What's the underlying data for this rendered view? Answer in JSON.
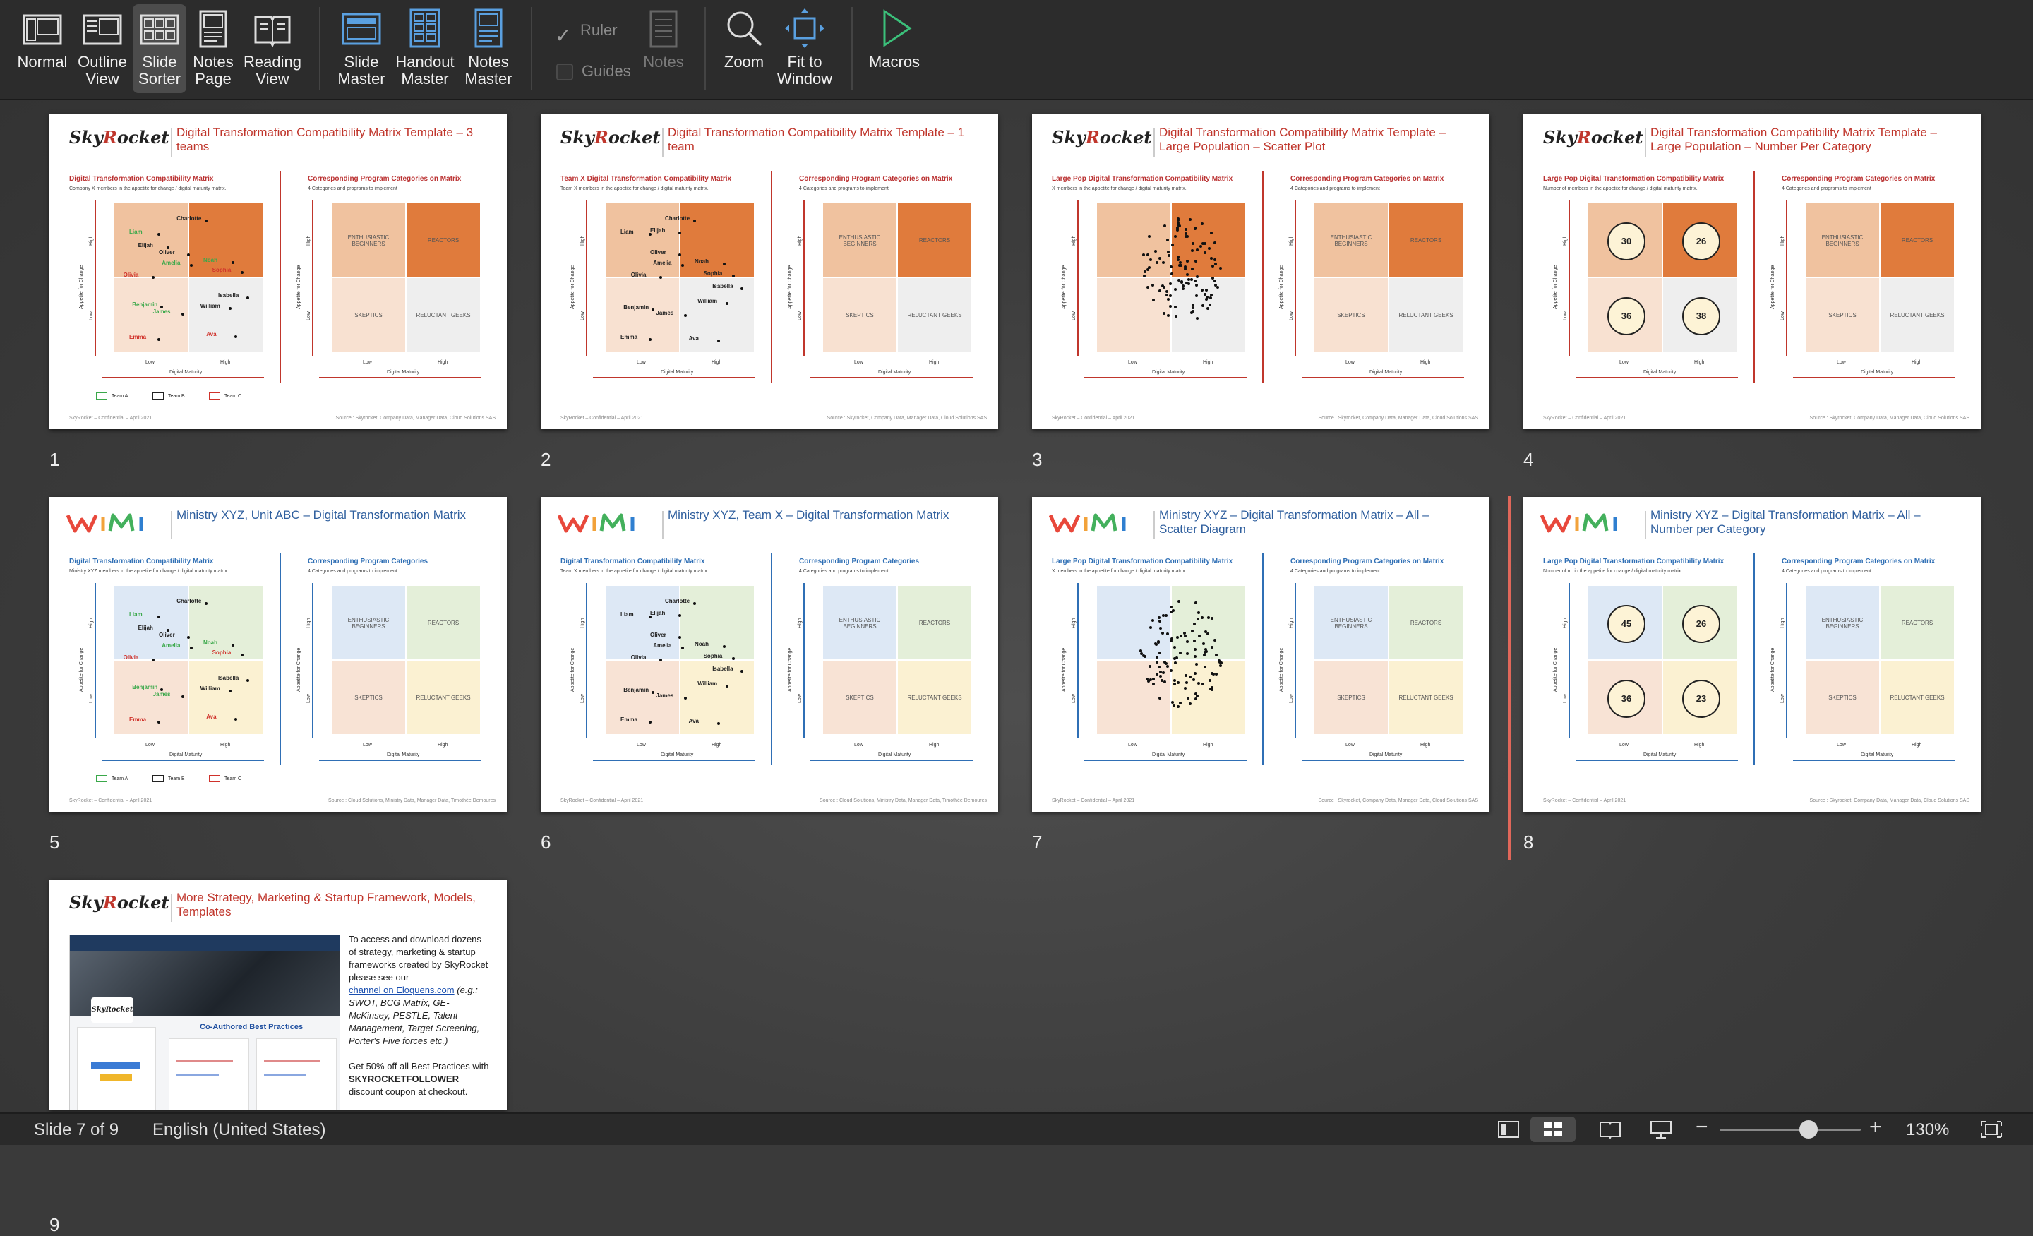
{
  "ribbon": {
    "views": [
      {
        "l1": "Normal",
        "l2": ""
      },
      {
        "l1": "Outline",
        "l2": "View"
      },
      {
        "l1": "Slide",
        "l2": "Sorter"
      },
      {
        "l1": "Notes",
        "l2": "Page"
      },
      {
        "l1": "Reading",
        "l2": "View"
      }
    ],
    "masters": [
      {
        "l1": "Slide",
        "l2": "Master"
      },
      {
        "l1": "Handout",
        "l2": "Master"
      },
      {
        "l1": "Notes",
        "l2": "Master"
      }
    ],
    "ruler_label": "Ruler",
    "guides_label": "Guides",
    "notes_label": "Notes",
    "zoom_label": "Zoom",
    "fit_l1": "Fit to",
    "fit_l2": "Window",
    "macros_label": "Macros"
  },
  "slides": [
    {
      "num": "1",
      "logo": "SkyRocket",
      "title": "Digital Transformation Compatibility Matrix Template – 3 teams",
      "left_sub": "Digital Transformation Compatibility Matrix",
      "left_desc": "Company X members in the appetite for change / digital maturity matrix.",
      "right_sub": "Corresponding Program Categories on Matrix",
      "right_desc": "4 Categories and programs to implement",
      "footer": "SkyRocket – Confidential – April 2021",
      "source": "Source : Skyrocket, Company Data, Manager Data, Cloud Solutions SAS"
    },
    {
      "num": "2",
      "logo": "SkyRocket",
      "title": "Digital Transformation Compatibility Matrix Template – 1 team",
      "left_sub": "Team X Digital Transformation Compatibility Matrix",
      "left_desc": "Team X members in the appetite for change / digital maturity matrix.",
      "right_sub": "Corresponding Program Categories on Matrix",
      "right_desc": "4 Categories and programs to implement",
      "footer": "SkyRocket – Confidential – April 2021",
      "source": "Source : Skyrocket, Company Data, Manager Data, Cloud Solutions SAS"
    },
    {
      "num": "3",
      "logo": "SkyRocket",
      "title": "Digital Transformation Compatibility Matrix Template – Large Population – Scatter Plot",
      "left_sub": "Large Pop Digital Transformation Compatibility Matrix",
      "left_desc": "X members in the appetite for change / digital maturity matrix.",
      "right_sub": "Corresponding Program Categories on Matrix",
      "right_desc": "4 Categories and programs to implement",
      "footer": "SkyRocket – Confidential – April 2021",
      "source": "Source : Skyrocket, Company Data, Manager Data, Cloud Solutions SAS"
    },
    {
      "num": "4",
      "logo": "SkyRocket",
      "title": "Digital Transformation Compatibility Matrix Template – Large Population – Number Per Category",
      "left_sub": "Large Pop Digital Transformation Compatibility Matrix",
      "left_desc": "Number of members in the appetite for change / digital maturity matrix.",
      "right_sub": "Corresponding Program Categories on Matrix",
      "right_desc": "4 Categories and programs to implement",
      "footer": "SkyRocket – Confidential – April 2021",
      "source": "Source : Skyrocket, Company Data, Manager Data, Cloud Solutions SAS",
      "counts": [
        "30",
        "26",
        "36",
        "38"
      ]
    },
    {
      "num": "5",
      "logo": "WIMI",
      "title": "Ministry XYZ, Unit ABC – Digital Transformation Matrix",
      "left_sub": "Digital Transformation Compatibility Matrix",
      "left_desc": "Ministry XYZ members in the appetite for change / digital maturity matrix.",
      "right_sub": "Corresponding Program Categories",
      "right_desc": "4 Categories and programs to implement",
      "footer": "SkyRocket – Confidential – April 2021",
      "source": "Source : Cloud Solutions, Ministry Data, Manager Data, Timothée Demoures"
    },
    {
      "num": "6",
      "logo": "WIMI",
      "title": "Ministry XYZ, Team X – Digital Transformation Matrix",
      "left_sub": "Digital Transformation Compatibility Matrix",
      "left_desc": "Team X members in the appetite for change / digital maturity matrix.",
      "right_sub": "Corresponding Program Categories",
      "right_desc": "4 Categories and programs to implement",
      "footer": "SkyRocket – Confidential – April 2021",
      "source": "Source : Cloud Solutions, Ministry Data, Manager Data, Timothée Demoures"
    },
    {
      "num": "7",
      "logo": "WIMI",
      "title": "Ministry XYZ – Digital Transformation Matrix – All – Scatter Diagram",
      "left_sub": "Large Pop Digital Transformation Compatibility Matrix",
      "left_desc": "X members in the appetite for change / digital maturity matrix.",
      "right_sub": "Corresponding Program Categories on Matrix",
      "right_desc": "4 Categories and programs to implement",
      "footer": "SkyRocket – Confidential – April 2021",
      "source": "Source : Skyrocket, Company Data, Manager Data, Cloud Solutions SAS"
    },
    {
      "num": "8",
      "logo": "WIMI",
      "title": "Ministry XYZ – Digital Transformation Matrix – All – Number per Category",
      "left_sub": "Large Pop Digital Transformation Compatibility Matrix",
      "left_desc": "Number of m. in the appetite for change / digital maturity matrix.",
      "right_sub": "Corresponding Program Categories on Matrix",
      "right_desc": "4 Categories and programs to implement",
      "footer": "SkyRocket – Confidential – April 2021",
      "source": "Source : Skyrocket, Company Data, Manager Data, Cloud Solutions SAS",
      "counts": [
        "45",
        "26",
        "36",
        "23"
      ]
    },
    {
      "num": "9",
      "logo": "SkyRocket",
      "title": "More Strategy, Marketing & Startup Framework, Models, Templates"
    }
  ],
  "matrix": {
    "categories": [
      "ENTHUSIASTIC BEGINNERS",
      "REACTORS",
      "SKEPTICS",
      "RELUCTANT GEEKS"
    ],
    "y_axis": "Appetite for Change",
    "x_axis": "Digital Maturity",
    "high": "High",
    "low": "Low",
    "teams": [
      "Team A",
      "Team B",
      "Team C"
    ]
  },
  "people": [
    {
      "name": "Charlotte",
      "team": "B"
    },
    {
      "name": "Liam",
      "team": "A"
    },
    {
      "name": "Elijah",
      "team": "B"
    },
    {
      "name": "Oliver",
      "team": "B"
    },
    {
      "name": "Amelia",
      "team": "A"
    },
    {
      "name": "Olivia",
      "team": "C"
    },
    {
      "name": "Noah",
      "team": "A"
    },
    {
      "name": "Sophia",
      "team": "C"
    },
    {
      "name": "Isabella",
      "team": "B"
    },
    {
      "name": "Benjamin",
      "team": "A"
    },
    {
      "name": "James",
      "team": "A"
    },
    {
      "name": "William",
      "team": "B"
    },
    {
      "name": "Emma",
      "team": "C"
    },
    {
      "name": "Ava",
      "team": "C"
    }
  ],
  "ad": {
    "line1": "To access and download dozens of strategy, marketing & startup frameworks created by SkyRocket please see our",
    "link": "channel on Eloquens.com",
    "examples": "(e.g.: SWOT, BCG Matrix, GE-McKinsey, PESTLE, Talent Management, Target Screening, Porter's Five forces etc.)",
    "offer": "Get 50% off all Best Practices with",
    "code": "SKYROCKETFOLLOWER",
    "offer_end": "discount coupon at checkout.",
    "shot_heading": "Co-Authored Best Practices",
    "shot_brand": "SkyRocket"
  },
  "status": {
    "slide_info": "Slide 7 of 9",
    "language": "English (United States)",
    "zoom": "130%",
    "zoom_level": 0.63
  },
  "colors": {
    "orange_dark": "#e07b3c",
    "orange_mid": "#f0c29f",
    "orange_light": "#f8e1d1",
    "grey_light": "#eeeeee",
    "wimi_blue": "#dde8f5",
    "wimi_green": "#e4efd9",
    "wimi_peach": "#f8e3d5",
    "wimi_yellow": "#fbf1d2",
    "accent_red": "#c0362c",
    "accent_blue": "#2f6fb5"
  }
}
